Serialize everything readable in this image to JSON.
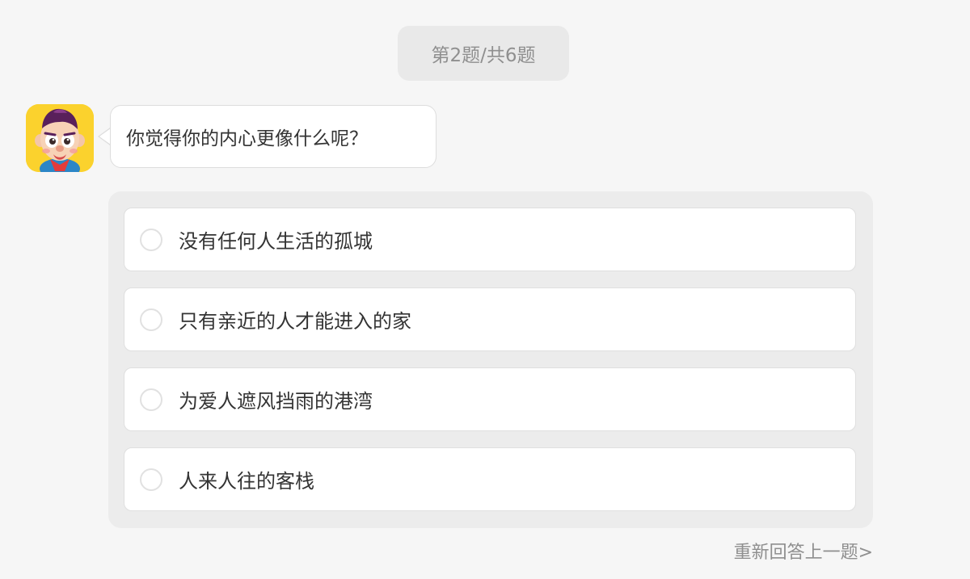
{
  "progress": {
    "label": "第2题/共6题"
  },
  "question": {
    "avatar": "cartoon-boy-avatar",
    "text": "你觉得你的内心更像什么呢？"
  },
  "options": [
    {
      "label": "没有任何人生活的孤城",
      "selected": false
    },
    {
      "label": "只有亲近的人才能进入的家",
      "selected": false
    },
    {
      "label": "为爱人遮风挡雨的港湾",
      "selected": false
    },
    {
      "label": "人来人往的客栈",
      "selected": false
    }
  ],
  "footer": {
    "prev_label": "重新回答上一题>"
  },
  "colors": {
    "background": "#f6f6f6",
    "avatar_background": "#fbd22d",
    "panel_background": "#ececec",
    "muted_text": "#8f8f8f"
  }
}
